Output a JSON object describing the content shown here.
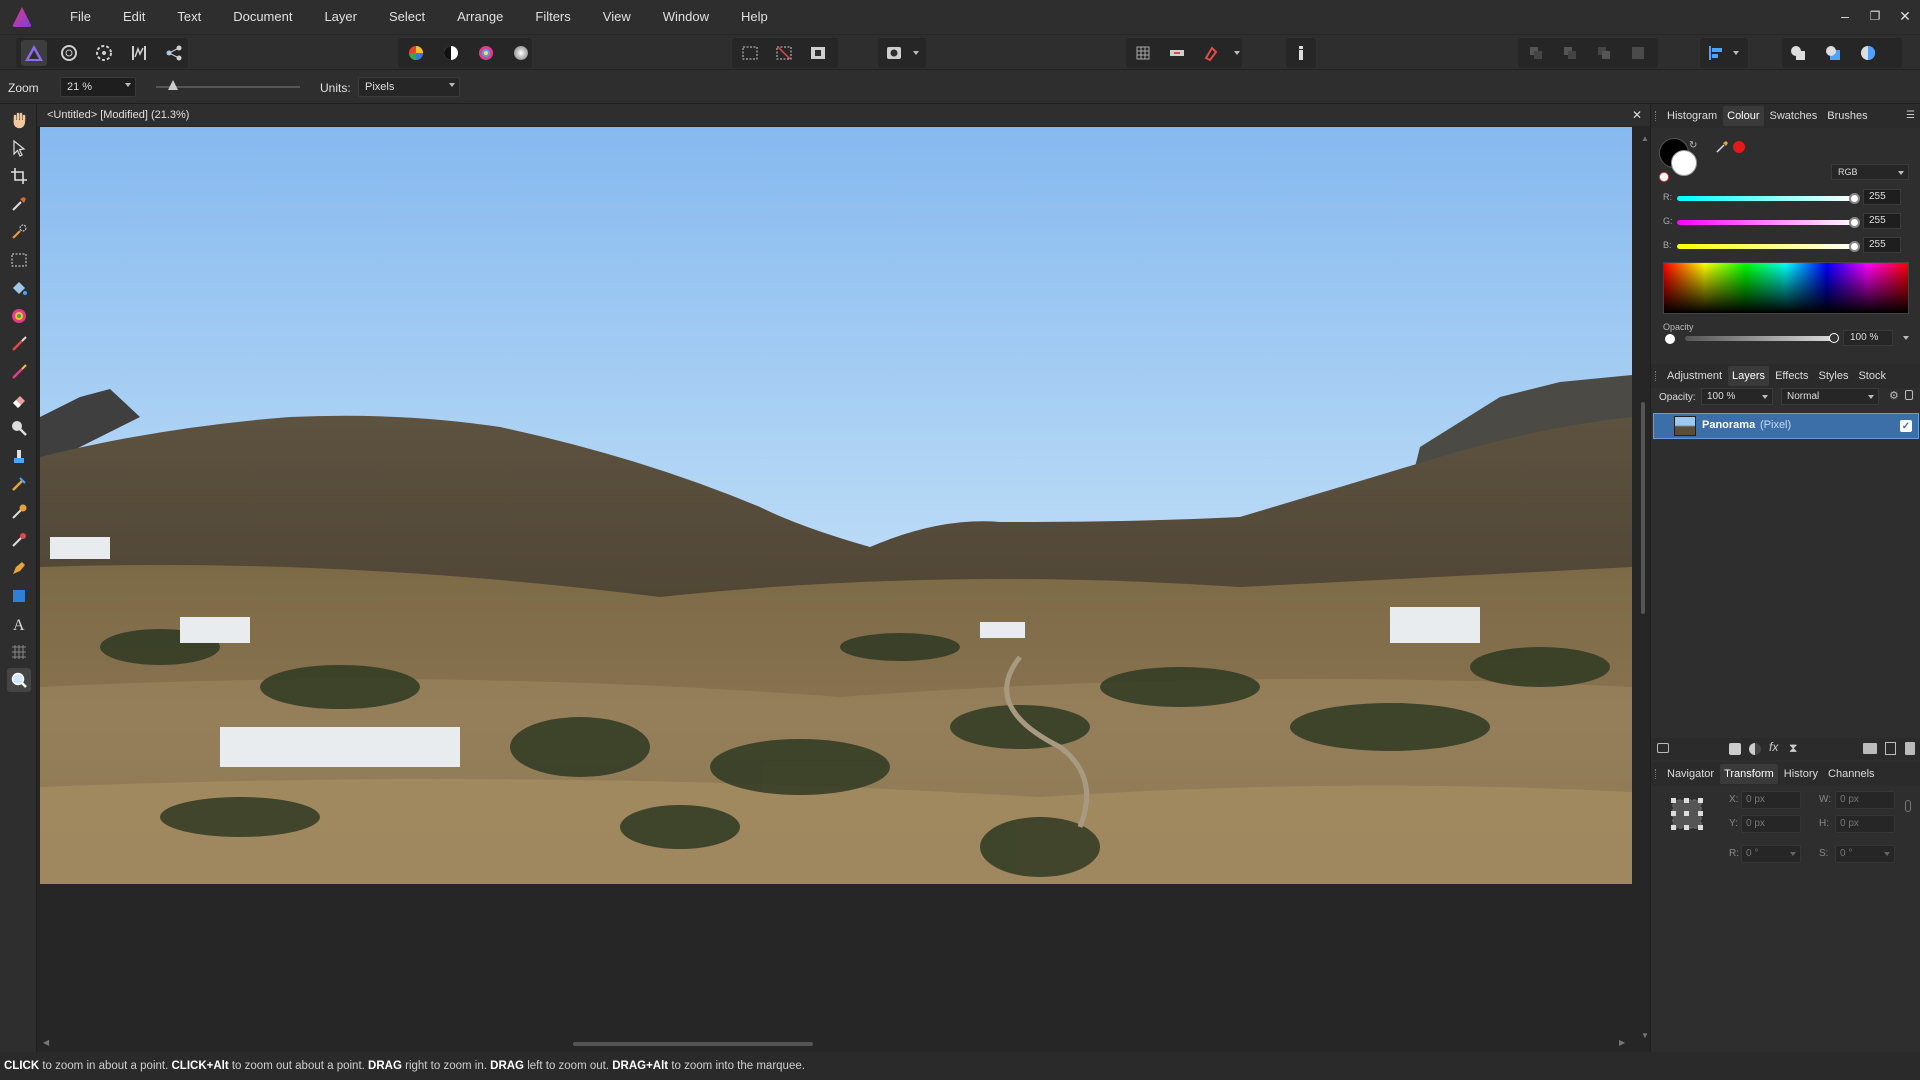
{
  "menubar": {
    "items": [
      "File",
      "Edit",
      "Text",
      "Document",
      "Layer",
      "Select",
      "Arrange",
      "Filters",
      "View",
      "Window",
      "Help"
    ],
    "window_controls": {
      "minimize": "–",
      "restore": "❐",
      "close": "✕"
    }
  },
  "context_toolbar": {
    "zoom_label": "Zoom",
    "zoom_value": "21 %",
    "units_label": "Units:",
    "units_value": "Pixels"
  },
  "document": {
    "tab_title": "<Untitled> [Modified] (21.3%)",
    "close_glyph": "✕"
  },
  "color_panel": {
    "tabs": [
      "Histogram",
      "Colour",
      "Swatches",
      "Brushes"
    ],
    "active_tab": "Colour",
    "mode": "RGB",
    "r_label": "R:",
    "r_value": "255",
    "g_label": "G:",
    "g_value": "255",
    "b_label": "B:",
    "b_value": "255",
    "opacity_label": "Opacity",
    "opacity_value": "100 %",
    "primary_color": "#000000",
    "secondary_color": "#ffffff",
    "accent_swatch": "#e21a1a"
  },
  "layers_panel": {
    "tabs": [
      "Adjustment",
      "Layers",
      "Effects",
      "Styles",
      "Stock"
    ],
    "active_tab": "Layers",
    "opacity_label": "Opacity:",
    "opacity_value": "100 %",
    "blend_mode": "Normal",
    "layers": [
      {
        "name": "Panorama",
        "type": "(Pixel)",
        "visible": true
      }
    ]
  },
  "transform_panel": {
    "tabs": [
      "Navigator",
      "Transform",
      "History",
      "Channels"
    ],
    "active_tab": "Transform",
    "x_label": "X:",
    "x_value": "0 px",
    "y_label": "Y:",
    "y_value": "0 px",
    "w_label": "W:",
    "w_value": "0 px",
    "h_label": "H:",
    "h_value": "0 px",
    "r_label": "R:",
    "r_value": "0 °",
    "s_label": "S:",
    "s_value": "0 °"
  },
  "status": {
    "parts": [
      {
        "b": "CLICK",
        "t": " to zoom in about a point. "
      },
      {
        "b": "CLICK+Alt",
        "t": " to zoom out about a point. "
      },
      {
        "b": "DRAG",
        "t": " right to zoom in. "
      },
      {
        "b": "DRAG",
        "t": " left to zoom out. "
      },
      {
        "b": "DRAG+Alt",
        "t": " to zoom into the marquee."
      }
    ]
  },
  "icons": {
    "personas": [
      "photo-persona-icon",
      "liquify-persona-icon",
      "develop-persona-icon",
      "tone-mapping-persona-icon",
      "export-persona-icon"
    ],
    "tools": [
      "view-tool-icon",
      "move-tool-icon",
      "crop-tool-icon",
      "color-picker-icon",
      "selection-brush-icon",
      "marquee-tool-icon",
      "flood-fill-icon",
      "gradient-tool-icon",
      "paint-brush-icon",
      "color-replace-icon",
      "erase-brush-icon",
      "dodge-brush-icon",
      "clone-brush-icon",
      "healing-brush-icon",
      "smudge-brush-icon",
      "red-eye-icon",
      "pen-tool-icon",
      "rectangle-tool-icon",
      "text-tool-icon",
      "mesh-warp-icon",
      "zoom-tool-icon"
    ]
  }
}
